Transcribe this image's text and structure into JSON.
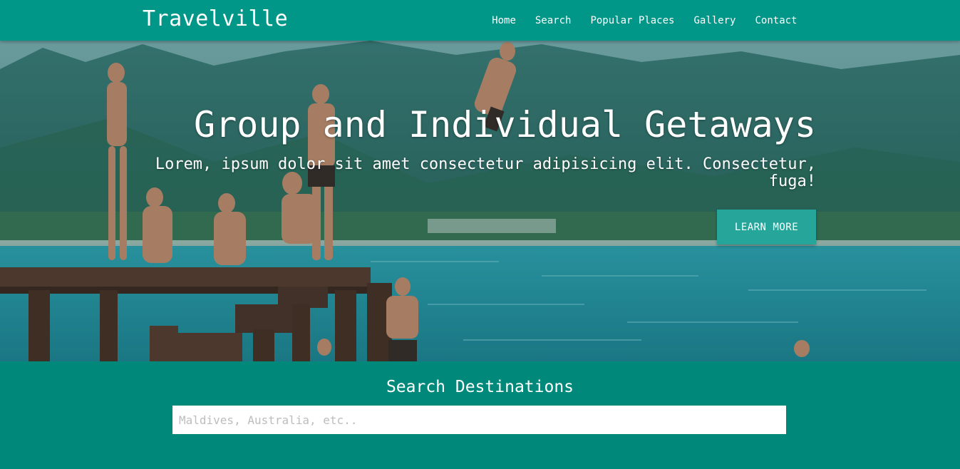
{
  "brand": "Travelville",
  "nav": {
    "items": [
      "Home",
      "Search",
      "Popular Places",
      "Gallery",
      "Contact"
    ]
  },
  "hero": {
    "title": "Group and Individual Getaways",
    "subtitle": "Lorem, ipsum dolor sit amet consectetur adipisicing elit. Consectetur, fuga!",
    "button_label": "LEARN MORE"
  },
  "search": {
    "title": "Search Destinations",
    "placeholder": "Maldives, Australia, etc..",
    "value": ""
  },
  "colors": {
    "navbar": "#009688",
    "section": "#00897b",
    "button": "#26a69a"
  }
}
